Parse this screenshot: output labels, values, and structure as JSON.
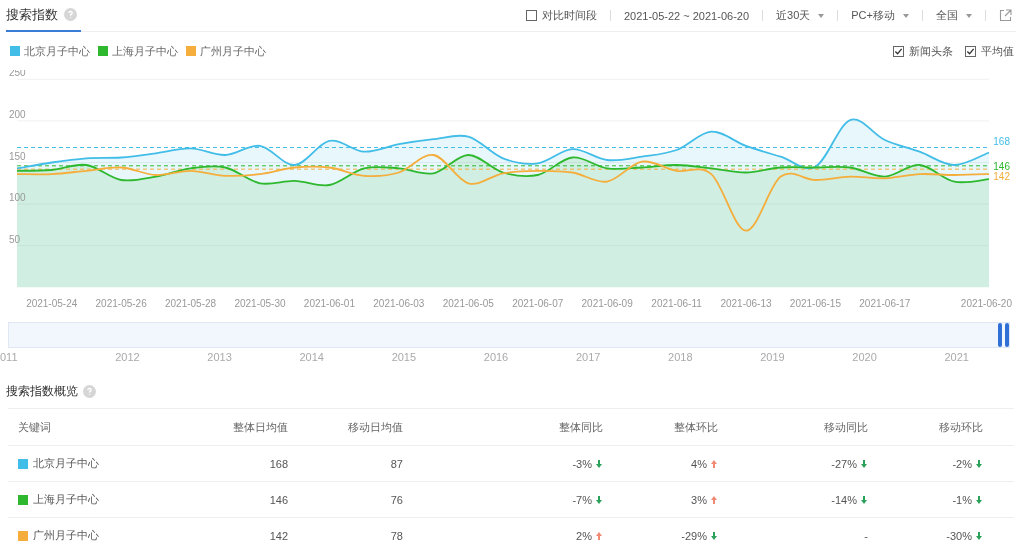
{
  "tab": {
    "label": "搜索指数",
    "selected": true
  },
  "toolbar": {
    "compare": {
      "label": "对比时间段",
      "checked": false
    },
    "date_range": "2021-05-22 ~ 2021-06-20",
    "dropdowns": [
      "近30天",
      "PC+移动",
      "全国"
    ]
  },
  "options": [
    {
      "label": "新闻头条",
      "checked": true
    },
    {
      "label": "平均值",
      "checked": true
    }
  ],
  "chart_data": {
    "type": "area",
    "grid": true,
    "categories": [
      null,
      "2021-05-24",
      null,
      "2021-05-26",
      null,
      "2021-05-28",
      null,
      "2021-05-30",
      null,
      "2021-06-01",
      null,
      "2021-06-03",
      null,
      "2021-06-05",
      null,
      "2021-06-07",
      null,
      "2021-06-09",
      null,
      "2021-06-11",
      null,
      "2021-06-13",
      null,
      "2021-06-15",
      null,
      "2021-06-17",
      null,
      null,
      "2021-06-20"
    ],
    "series": [
      {
        "name": "北京月子中心",
        "color": "#42bde7",
        "values": [
          143,
          150,
          155,
          156,
          161,
          167,
          159,
          170,
          147,
          176,
          163,
          172,
          178,
          181,
          155,
          149,
          166,
          153,
          157,
          165,
          187,
          170,
          157,
          145,
          201,
          177,
          163,
          147,
          162
        ]
      },
      {
        "name": "上海月子中心",
        "color": "#2db82d",
        "values": [
          140,
          141,
          147,
          129,
          133,
          143,
          144,
          125,
          128,
          123,
          143,
          143,
          137,
          159,
          138,
          135,
          156,
          143,
          144,
          147,
          143,
          138,
          144,
          144,
          144,
          133,
          147,
          127,
          130
        ]
      },
      {
        "name": "广州月子中心",
        "color": "#f5ad3b",
        "type": "line",
        "values": [
          136,
          136,
          140,
          144,
          135,
          140,
          134,
          136,
          144,
          144,
          134,
          138,
          159,
          125,
          137,
          140,
          138,
          127,
          151,
          140,
          136,
          68,
          133,
          129,
          133,
          131,
          136,
          135,
          136
        ]
      }
    ],
    "ylim": [
      0,
      250
    ],
    "yticks": [
      50,
      100,
      150,
      200,
      250
    ],
    "ref_lines": [
      {
        "axis": "y",
        "value": 168,
        "label": "168",
        "color": "#42bde7"
      },
      {
        "axis": "y",
        "value": 146,
        "label": "146",
        "color": "#2db82d"
      },
      {
        "axis": "y",
        "value": 142,
        "label": "142",
        "color": "#f5ad3b"
      }
    ]
  },
  "navigator": {
    "years": [
      "011",
      "2012",
      "2013",
      "2014",
      "2015",
      "2016",
      "2017",
      "2018",
      "2019",
      "2020",
      "2021"
    ]
  },
  "overview": {
    "title": "搜索指数概览",
    "columns": [
      "关键词",
      "整体日均值",
      "移动日均值",
      "整体同比",
      "整体环比",
      "移动同比",
      "移动环比"
    ],
    "rows": [
      {
        "keyword": "北京月子中心",
        "color": "#42bde7",
        "values": [
          "168",
          "87"
        ],
        "changes": [
          {
            "text": "-3%",
            "rising": false
          },
          {
            "text": "4%",
            "rising": true
          },
          {
            "text": "-27%",
            "rising": false
          },
          {
            "text": "-2%",
            "rising": false
          }
        ]
      },
      {
        "keyword": "上海月子中心",
        "color": "#2db82d",
        "values": [
          "146",
          "76"
        ],
        "changes": [
          {
            "text": "-7%",
            "rising": false
          },
          {
            "text": "3%",
            "rising": true
          },
          {
            "text": "-14%",
            "rising": false
          },
          {
            "text": "-1%",
            "rising": false
          }
        ]
      },
      {
        "keyword": "广州月子中心",
        "color": "#f5ad3b",
        "values": [
          "142",
          "78"
        ],
        "changes": [
          {
            "text": "2%",
            "rising": true
          },
          {
            "text": "-29%",
            "rising": false
          },
          {
            "text": "-"
          },
          {
            "text": "-30%",
            "rising": false
          }
        ]
      }
    ]
  }
}
